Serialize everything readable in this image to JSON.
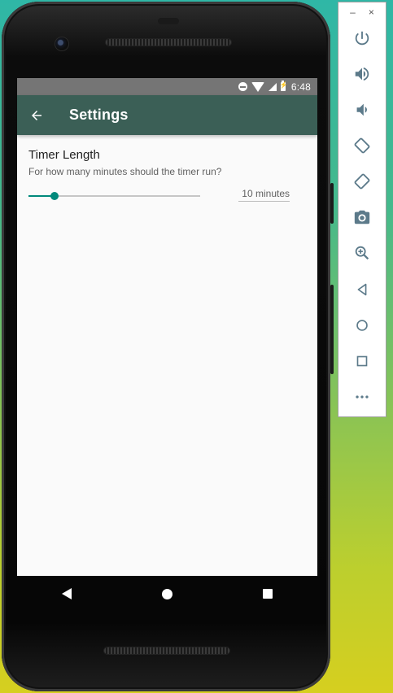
{
  "status_bar": {
    "time": "6:48"
  },
  "app_bar": {
    "title": "Settings"
  },
  "preference": {
    "title": "Timer Length",
    "summary": "For how many minutes should the timer run?",
    "value_label": "10 minutes",
    "slider_fraction": 0.15
  },
  "toolbar": {
    "minimize_glyph": "–",
    "close_glyph": "×",
    "buttons": [
      "power-icon",
      "volume-up-icon",
      "volume-down-icon",
      "rotate-left-icon",
      "rotate-right-icon",
      "camera-icon",
      "zoom-icon",
      "back-icon",
      "home-icon",
      "overview-icon",
      "more-icon"
    ]
  },
  "colors": {
    "app_bar": "#3b5f56",
    "accent": "#00897b",
    "status_bar": "#757575"
  }
}
